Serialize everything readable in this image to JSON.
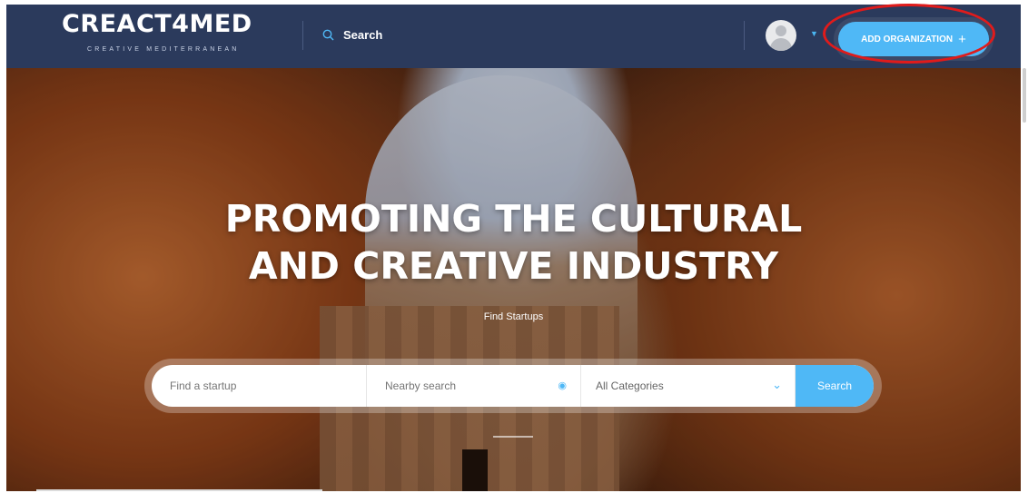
{
  "header": {
    "logo_main": "CREACT4MED",
    "logo_sub": "CREATIVE MEDITERRANEAN",
    "search_label": "Search",
    "add_button_label": "ADD ORGANIZATION",
    "add_button_icon": "+",
    "colors": {
      "bar": "#2b3a5c",
      "accent": "#4fb8f6",
      "highlight": "#e01b1b"
    }
  },
  "hero": {
    "title_line1": "PROMOTING THE CULTURAL",
    "title_line2": "AND CREATIVE INDUSTRY",
    "subtitle": "Find Startups"
  },
  "search_form": {
    "startup_placeholder": "Find a startup",
    "nearby_placeholder": "Nearby search",
    "category_value": "All Categories",
    "search_button": "Search"
  }
}
